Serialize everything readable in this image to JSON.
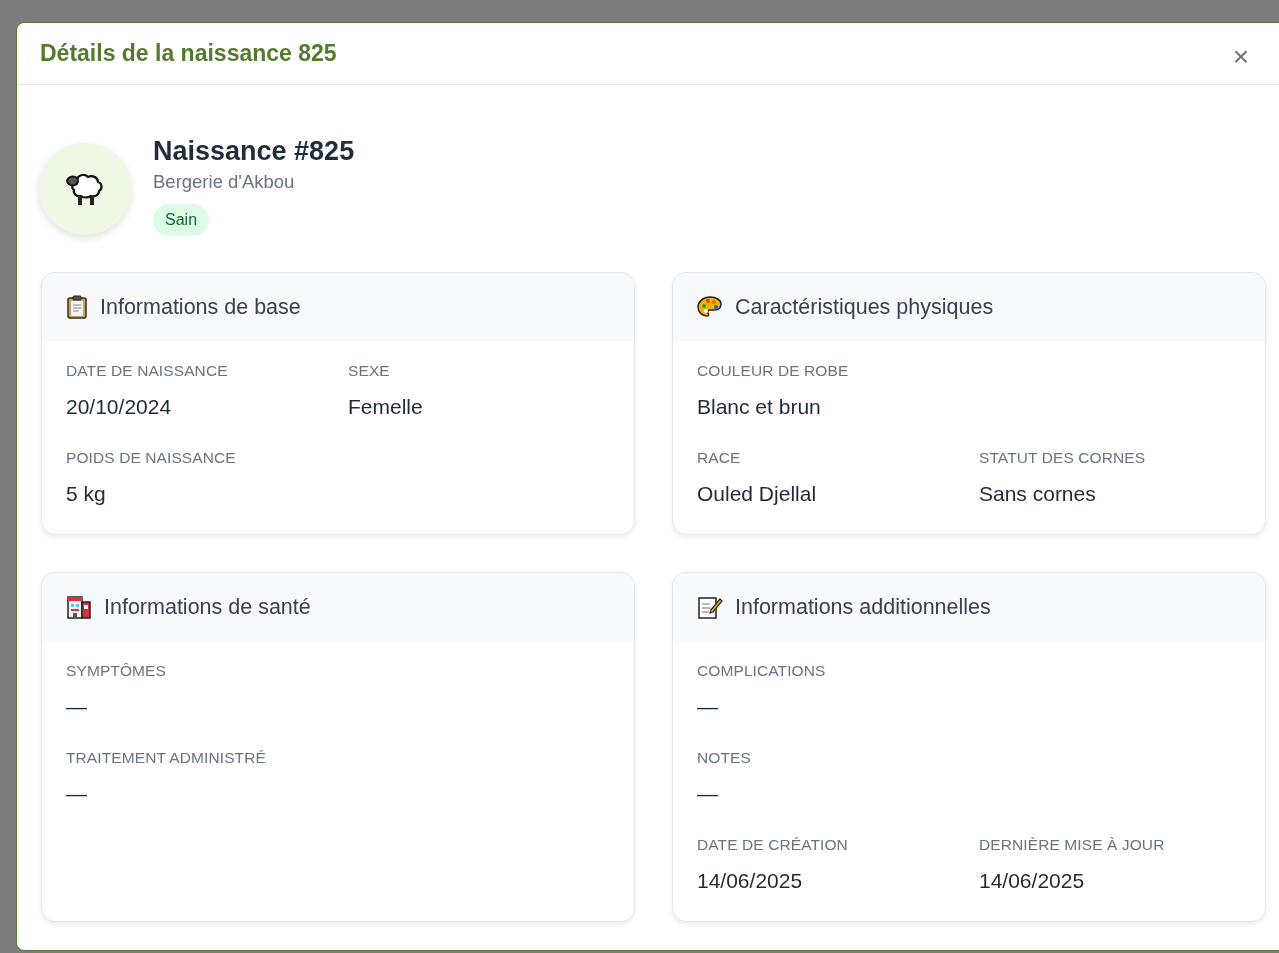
{
  "modal": {
    "title": "Détails de la naissance 825",
    "close": "×"
  },
  "summary": {
    "title": "Naissance #825",
    "subtitle": "Bergerie d'Akbou",
    "status": "Sain"
  },
  "cards": [
    {
      "title": "Informations de base",
      "fields": [
        {
          "label": "DATE DE NAISSANCE",
          "value": "20/10/2024",
          "wide": false
        },
        {
          "label": "SEXE",
          "value": "Femelle",
          "wide": false
        },
        {
          "label": "POIDS DE NAISSANCE",
          "value": "5 kg",
          "wide": false
        }
      ]
    },
    {
      "title": "Caractéristiques physiques",
      "fields": [
        {
          "label": "COULEUR DE ROBE",
          "value": "Blanc et brun",
          "wide": true
        },
        {
          "label": "RACE",
          "value": "Ouled Djellal",
          "wide": false
        },
        {
          "label": "STATUT DES CORNES",
          "value": "Sans cornes",
          "wide": false
        }
      ]
    },
    {
      "title": "Informations de santé",
      "fields": [
        {
          "label": "SYMPTÔMES",
          "value": "—",
          "wide": true
        },
        {
          "label": "TRAITEMENT ADMINISTRÉ",
          "value": "—",
          "wide": true
        }
      ]
    },
    {
      "title": "Informations additionnelles",
      "fields": [
        {
          "label": "COMPLICATIONS",
          "value": "—",
          "wide": true
        },
        {
          "label": "NOTES",
          "value": "—",
          "wide": true
        },
        {
          "label": "DATE DE CRÉATION",
          "value": "14/06/2025",
          "wide": false
        },
        {
          "label": "DERNIÈRE MISE À JOUR",
          "value": "14/06/2025",
          "wide": false
        }
      ]
    }
  ]
}
